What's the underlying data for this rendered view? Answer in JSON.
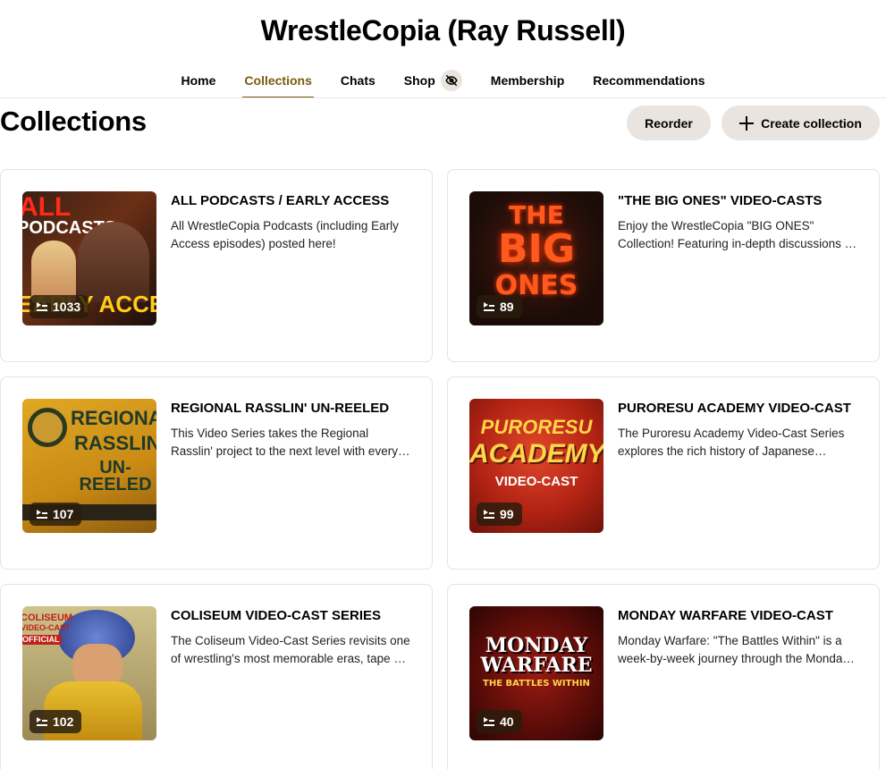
{
  "header": {
    "creator_name": "WrestleCopia (Ray Russell)"
  },
  "nav": {
    "tabs": [
      {
        "label": "Home"
      },
      {
        "label": "Collections"
      },
      {
        "label": "Chats"
      },
      {
        "label": "Shop"
      },
      {
        "label": "Membership"
      },
      {
        "label": "Recommendations"
      }
    ],
    "active_tab": "Collections",
    "shop_badge_icon": "eye-off-icon"
  },
  "main": {
    "title": "Collections",
    "reorder_label": "Reorder",
    "create_label": "Create collection"
  },
  "collections": [
    {
      "title": "ALL PODCASTS / EARLY ACCESS",
      "description": "All WrestleCopia Podcasts (including Early Access episodes) posted here!",
      "count": "1033",
      "art_top": "ALL",
      "art_mid": "PODCASTS",
      "art_bottom": "EARLY ACCESS"
    },
    {
      "title": "\"THE BIG ONES\" VIDEO-CASTS",
      "description": "Enjoy the WrestleCopia \"BIG ONES\" Collection! Featuring in-depth discussions of the biggest events.",
      "count": "89",
      "art_top": "THE",
      "art_mid": "BIG",
      "art_bottom": "ONES"
    },
    {
      "title": "REGIONAL RASSLIN' UN-REELED",
      "description": "This Video Series takes the Regional Rasslin' project to the next level with every episode.",
      "count": "107",
      "art_top": "REGIONAL",
      "art_mid": "RASSLIN'",
      "art_bottom": "UN-REELED"
    },
    {
      "title": "PURORESU ACADEMY VIDEO-CAST",
      "description": "The Puroresu Academy Video-Cast Series explores the rich history of Japanese wrestling.",
      "count": "99",
      "art_top": "PURORESU",
      "art_mid": "ACADEMY",
      "art_bottom": "VIDEO-CAST"
    },
    {
      "title": "COLISEUM VIDEO-CAST SERIES",
      "description": "The Coliseum Video-Cast Series revisits one of wrestling's most memorable eras, tape by tape.",
      "count": "102",
      "art_top": "COLISEUM",
      "art_mid": "VIDEO-CAST",
      "art_bottom": "OFFICIAL"
    },
    {
      "title": "MONDAY WARFARE VIDEO-CAST",
      "description": "Monday Warfare: \"The Battles Within\" is a week-by-week journey through the Monday Night Wars.",
      "count": "40",
      "art_top": "MONDAY",
      "art_mid": "WARFARE",
      "art_bottom": "THE BATTLES WITHIN"
    }
  ],
  "colors": {
    "accent": "#7a5a12",
    "button_bg": "#e9e4df"
  }
}
